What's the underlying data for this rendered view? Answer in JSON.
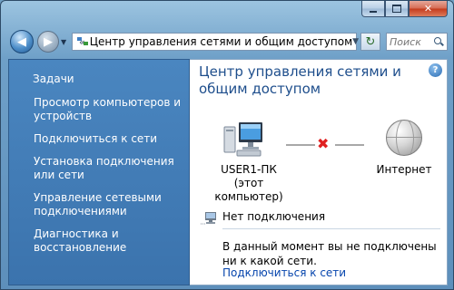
{
  "window": {
    "caption_icons": [
      "minimize-icon",
      "maximize-icon",
      "close-icon"
    ]
  },
  "toolbar": {
    "address_text": "Центр управления сетями и общим доступом",
    "search_placeholder": "Поиск",
    "icons": [
      "back-arrow-icon",
      "forward-arrow-icon",
      "network-folder-icon",
      "chevron-down-icon",
      "refresh-icon",
      "search-icon"
    ]
  },
  "sidebar": {
    "title": "Задачи",
    "items": [
      {
        "label": "Просмотр компьютеров и устройств",
        "interactable": true
      },
      {
        "label": "Подключиться к сети",
        "interactable": true
      },
      {
        "label": "Установка подключения или сети",
        "interactable": true
      },
      {
        "label": "Управление сетевыми подключениями",
        "interactable": true
      },
      {
        "label": "Диагностика и восстановление",
        "interactable": true
      }
    ]
  },
  "main": {
    "title": "Центр управления сетями и общим доступом",
    "computer_name": "USER1-ПК",
    "computer_sub": "(этот компьютер)",
    "internet_label": "Интернет",
    "status": "Нет подключения",
    "message": "В данный момент вы не подключены ни к какой сети.",
    "connect_link": "Подключиться к сети",
    "connection_state": "disconnected",
    "colors": {
      "title": "#1e4e8c",
      "link": "#0645ad",
      "sidebar": "#3b73ad",
      "disconnect": "#e02020"
    }
  }
}
